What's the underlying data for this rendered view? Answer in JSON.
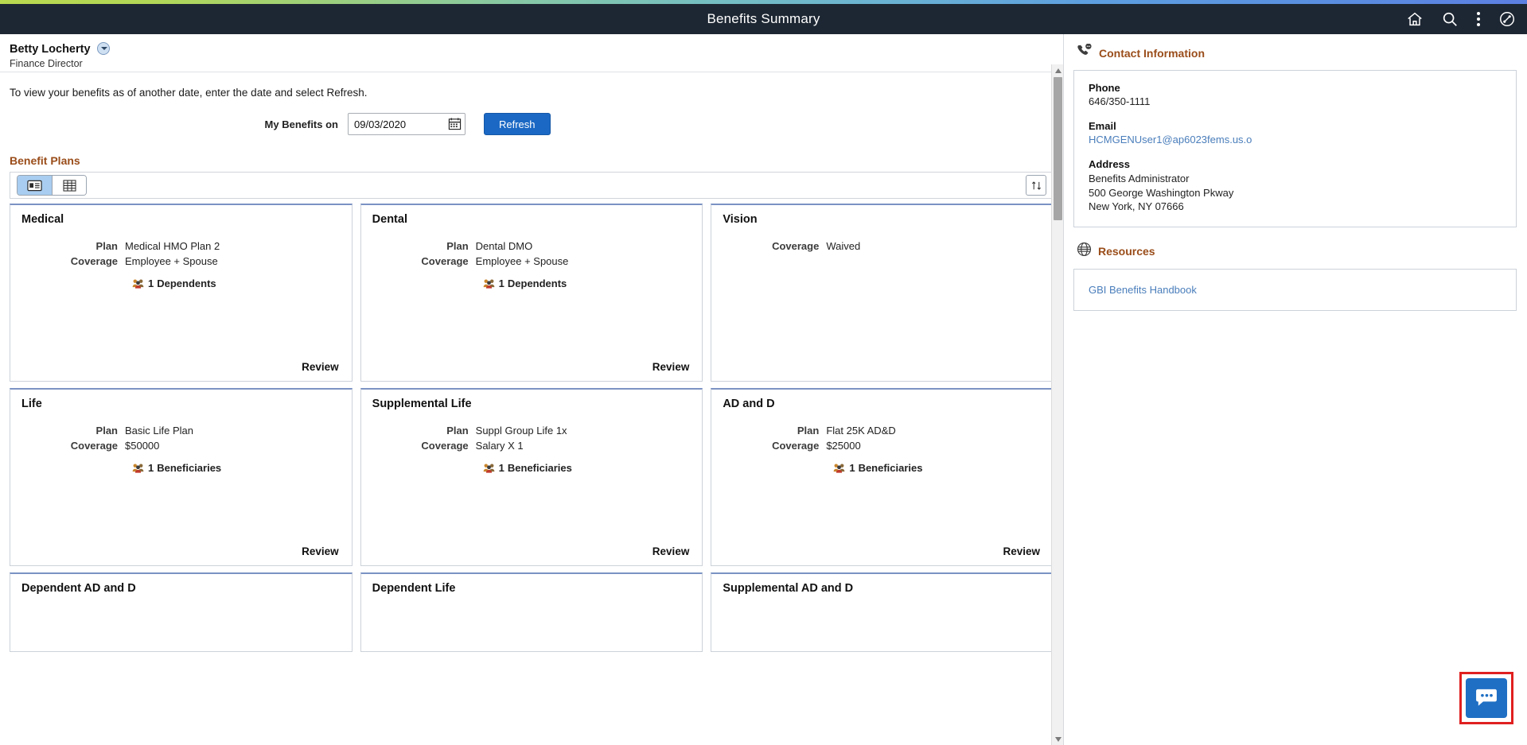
{
  "header": {
    "title": "Benefits Summary",
    "icons": [
      {
        "name": "home-icon",
        "label": "Home"
      },
      {
        "name": "search-icon",
        "label": "Search"
      },
      {
        "name": "actions-menu-icon",
        "label": "Actions"
      },
      {
        "name": "navigator-icon",
        "label": "Navigator"
      }
    ],
    "background": "#1d2733"
  },
  "person": {
    "name": "Betty Locherty",
    "title": "Finance Director"
  },
  "instructions": {
    "text": "To view your benefits as of another date, enter the date and select Refresh."
  },
  "date_row": {
    "label": "My Benefits on",
    "value": "09/03/2020",
    "placeholder": "MM/DD/YYYY",
    "refresh_label": "Refresh",
    "refresh_color": "#1b68c4"
  },
  "benefit_plans": {
    "section_title": "Benefit Plans",
    "section_title_color": "#9a4d1a",
    "toolbar": {
      "view_tile_label": "Tile View",
      "view_grid_label": "Grid View",
      "active_view": "tile",
      "sort_label": "Sort"
    },
    "row_labels": {
      "plan": "Plan",
      "coverage": "Coverage"
    },
    "review_label": "Review",
    "cards": [
      {
        "title": "Medical",
        "plan": "Medical HMO Plan 2",
        "coverage": "Employee + Spouse",
        "extra_count": "1",
        "extra_label": "Dependents",
        "has_review": true
      },
      {
        "title": "Dental",
        "plan": "Dental DMO",
        "coverage": "Employee + Spouse",
        "extra_count": "1",
        "extra_label": "Dependents",
        "has_review": true
      },
      {
        "title": "Vision",
        "plan": "",
        "coverage": "Waived",
        "extra_count": "",
        "extra_label": "",
        "has_review": false
      },
      {
        "title": "Life",
        "plan": "Basic Life Plan",
        "coverage": "$50000",
        "extra_count": "1",
        "extra_label": "Beneficiaries",
        "has_review": true
      },
      {
        "title": "Supplemental Life",
        "plan": "Suppl Group Life 1x",
        "coverage": "Salary X 1",
        "extra_count": "1",
        "extra_label": "Beneficiaries",
        "has_review": true
      },
      {
        "title": "AD and D",
        "plan": "Flat 25K AD&D",
        "coverage": "$25000",
        "extra_count": "1",
        "extra_label": "Beneficiaries",
        "has_review": true
      },
      {
        "title": "Dependent AD and D",
        "plan": "",
        "coverage": "",
        "extra_count": "",
        "extra_label": "",
        "has_review": false
      },
      {
        "title": "Dependent Life",
        "plan": "",
        "coverage": "",
        "extra_count": "",
        "extra_label": "",
        "has_review": false
      },
      {
        "title": "Supplemental AD and D",
        "plan": "",
        "coverage": "",
        "extra_count": "",
        "extra_label": "",
        "has_review": false
      }
    ]
  },
  "sidebar": {
    "contact": {
      "section_title": "Contact Information",
      "phone_label": "Phone",
      "phone_value": "646/350-1111",
      "email_label": "Email",
      "email_value": "HCMGENUser1@ap6023fems.us.o",
      "email_color": "#4a7ebb",
      "address_label": "Address",
      "address_line1": "Benefits Administrator",
      "address_line2": "500 George Washington Pkway",
      "address_line3": "New York, NY 07666"
    },
    "resources": {
      "section_title": "Resources",
      "links": [
        {
          "label": "GBI Benefits Handbook"
        }
      ]
    }
  },
  "chat": {
    "label": "Chat",
    "accent": "#1f6fc4",
    "focus_border": "#e02020"
  }
}
